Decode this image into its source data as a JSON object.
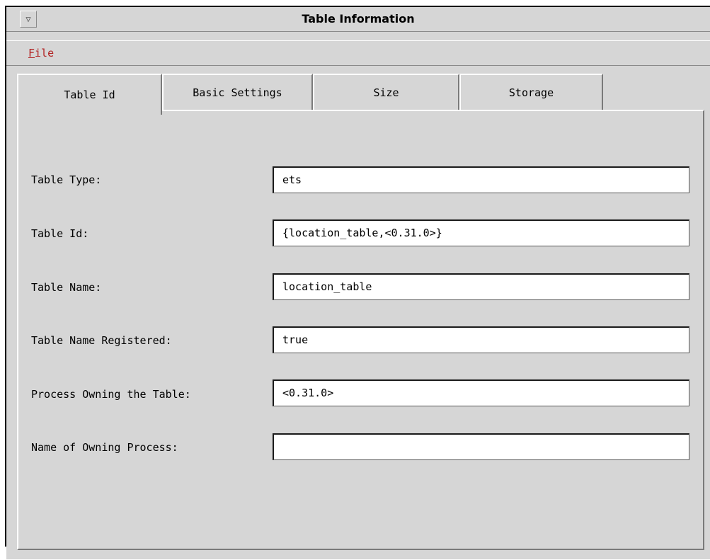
{
  "window": {
    "title": "Table Information",
    "menu_button_glyph": "▽"
  },
  "menu": {
    "file_mnemonic": "F",
    "file_rest": "ile"
  },
  "tabs": [
    {
      "label": "Table Id",
      "active": true
    },
    {
      "label": "Basic Settings",
      "active": false
    },
    {
      "label": "Size",
      "active": false
    },
    {
      "label": "Storage",
      "active": false
    }
  ],
  "fields": [
    {
      "label": "Table Type:",
      "value": "ets"
    },
    {
      "label": "Table Id:",
      "value": "{location_table,<0.31.0>}"
    },
    {
      "label": "Table Name:",
      "value": "location_table"
    },
    {
      "label": "Table Name Registered:",
      "value": "true"
    },
    {
      "label": "Process Owning the Table:",
      "value": "<0.31.0>"
    },
    {
      "label": "Name of Owning Process:",
      "value": ""
    }
  ],
  "colors": {
    "background": "#d6d6d6",
    "menu_text": "#b22222"
  }
}
